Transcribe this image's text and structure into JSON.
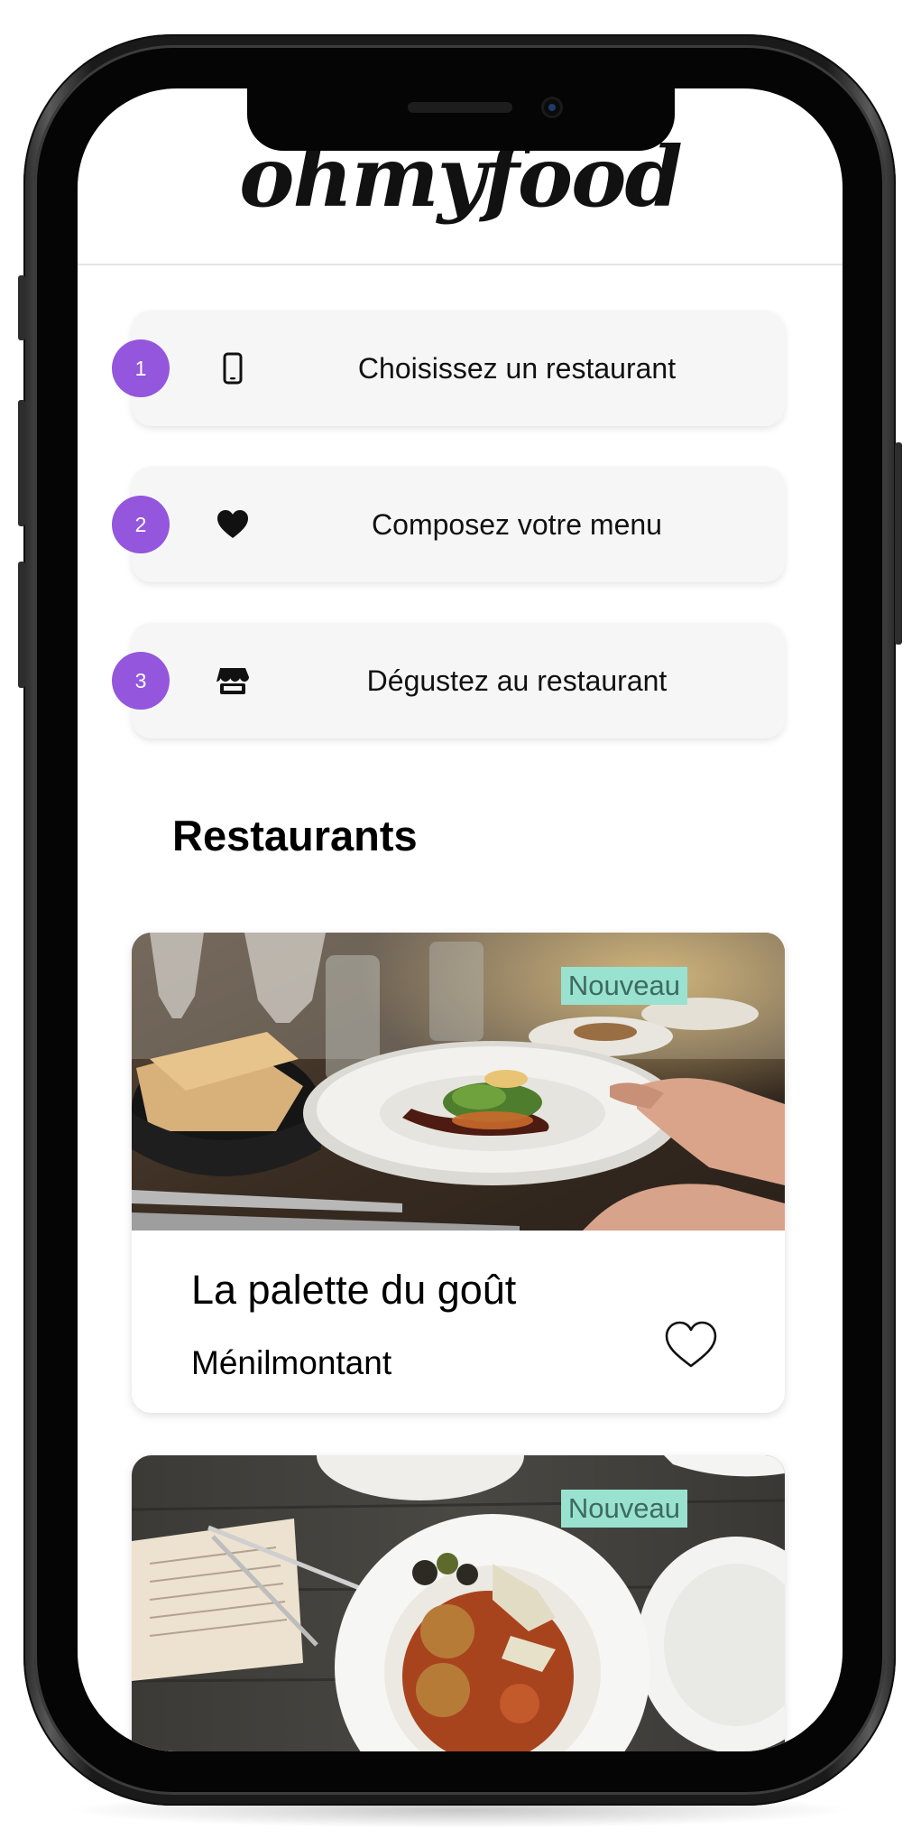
{
  "app": {
    "logo": "ohmyfood"
  },
  "steps": [
    {
      "number": "1",
      "icon": "smartphone-icon",
      "label": "Choisissez un restaurant"
    },
    {
      "number": "2",
      "icon": "heart-icon",
      "label": "Composez votre menu"
    },
    {
      "number": "3",
      "icon": "store-icon",
      "label": "Dégustez au restaurant"
    }
  ],
  "restaurants": {
    "title": "Restaurants",
    "items": [
      {
        "badge": "Nouveau",
        "name": "La palette du goût",
        "area": "Ménilmontant",
        "fav_icon": "heart-outline-icon"
      },
      {
        "badge": "Nouveau"
      }
    ]
  },
  "colors": {
    "accent": "#9356DC",
    "badge_bg": "#99E2D0",
    "badge_text": "#3E6A5F",
    "step_bg": "#F6F6F6"
  }
}
